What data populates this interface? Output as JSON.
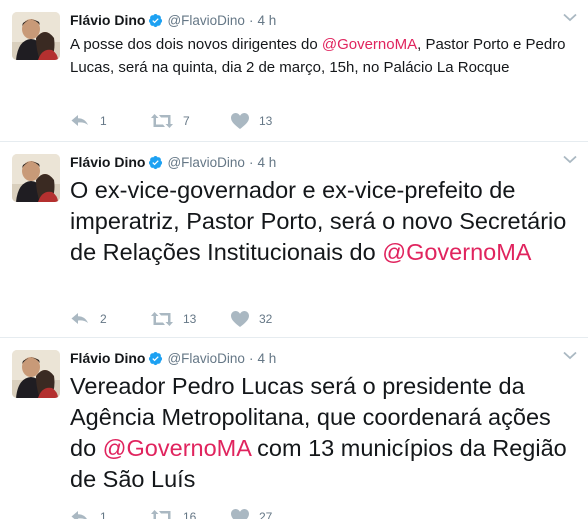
{
  "colors": {
    "mention": "#e0245e",
    "verified": "#1da1f2",
    "meta": "#657786",
    "divider": "#e6ecf0"
  },
  "icons": {
    "reply": "reply-icon",
    "retweet": "retweet-icon",
    "like": "heart-icon",
    "verified": "verified-badge-icon",
    "more": "chevron-down-icon"
  },
  "tweets": [
    {
      "author": {
        "name": "Flávio Dino",
        "handle": "@FlavioDino"
      },
      "separator": "·",
      "time": "4 h",
      "text": {
        "before": "A posse dos dois novos dirigentes do ",
        "mention": "@GovernoMA",
        "after": ", Pastor Porto e Pedro Lucas, será na quinta, dia 2 de março, 15h, no Palácio La Rocque"
      },
      "stats": {
        "replies": "1",
        "retweets": "7",
        "likes": "13"
      }
    },
    {
      "author": {
        "name": "Flávio Dino",
        "handle": "@FlavioDino"
      },
      "separator": "·",
      "time": "4 h",
      "text": {
        "before": "O ex-vice-governador e ex-vice-prefeito de imperatriz, Pastor Porto, será o novo Secretário de Relações Institucionais do ",
        "mention": "@GovernoMA",
        "after": ""
      },
      "stats": {
        "replies": "2",
        "retweets": "13",
        "likes": "32"
      }
    },
    {
      "author": {
        "name": "Flávio Dino",
        "handle": "@FlavioDino"
      },
      "separator": "·",
      "time": "4 h",
      "text": {
        "before": "Vereador Pedro Lucas será o presidente da Agência Metropolitana, que coordenará ações do ",
        "mention": "@GovernoMA",
        "after": " com 13 municípios da Região de São Luís"
      },
      "stats": {
        "replies": "1",
        "retweets": "16",
        "likes": "27"
      }
    }
  ]
}
